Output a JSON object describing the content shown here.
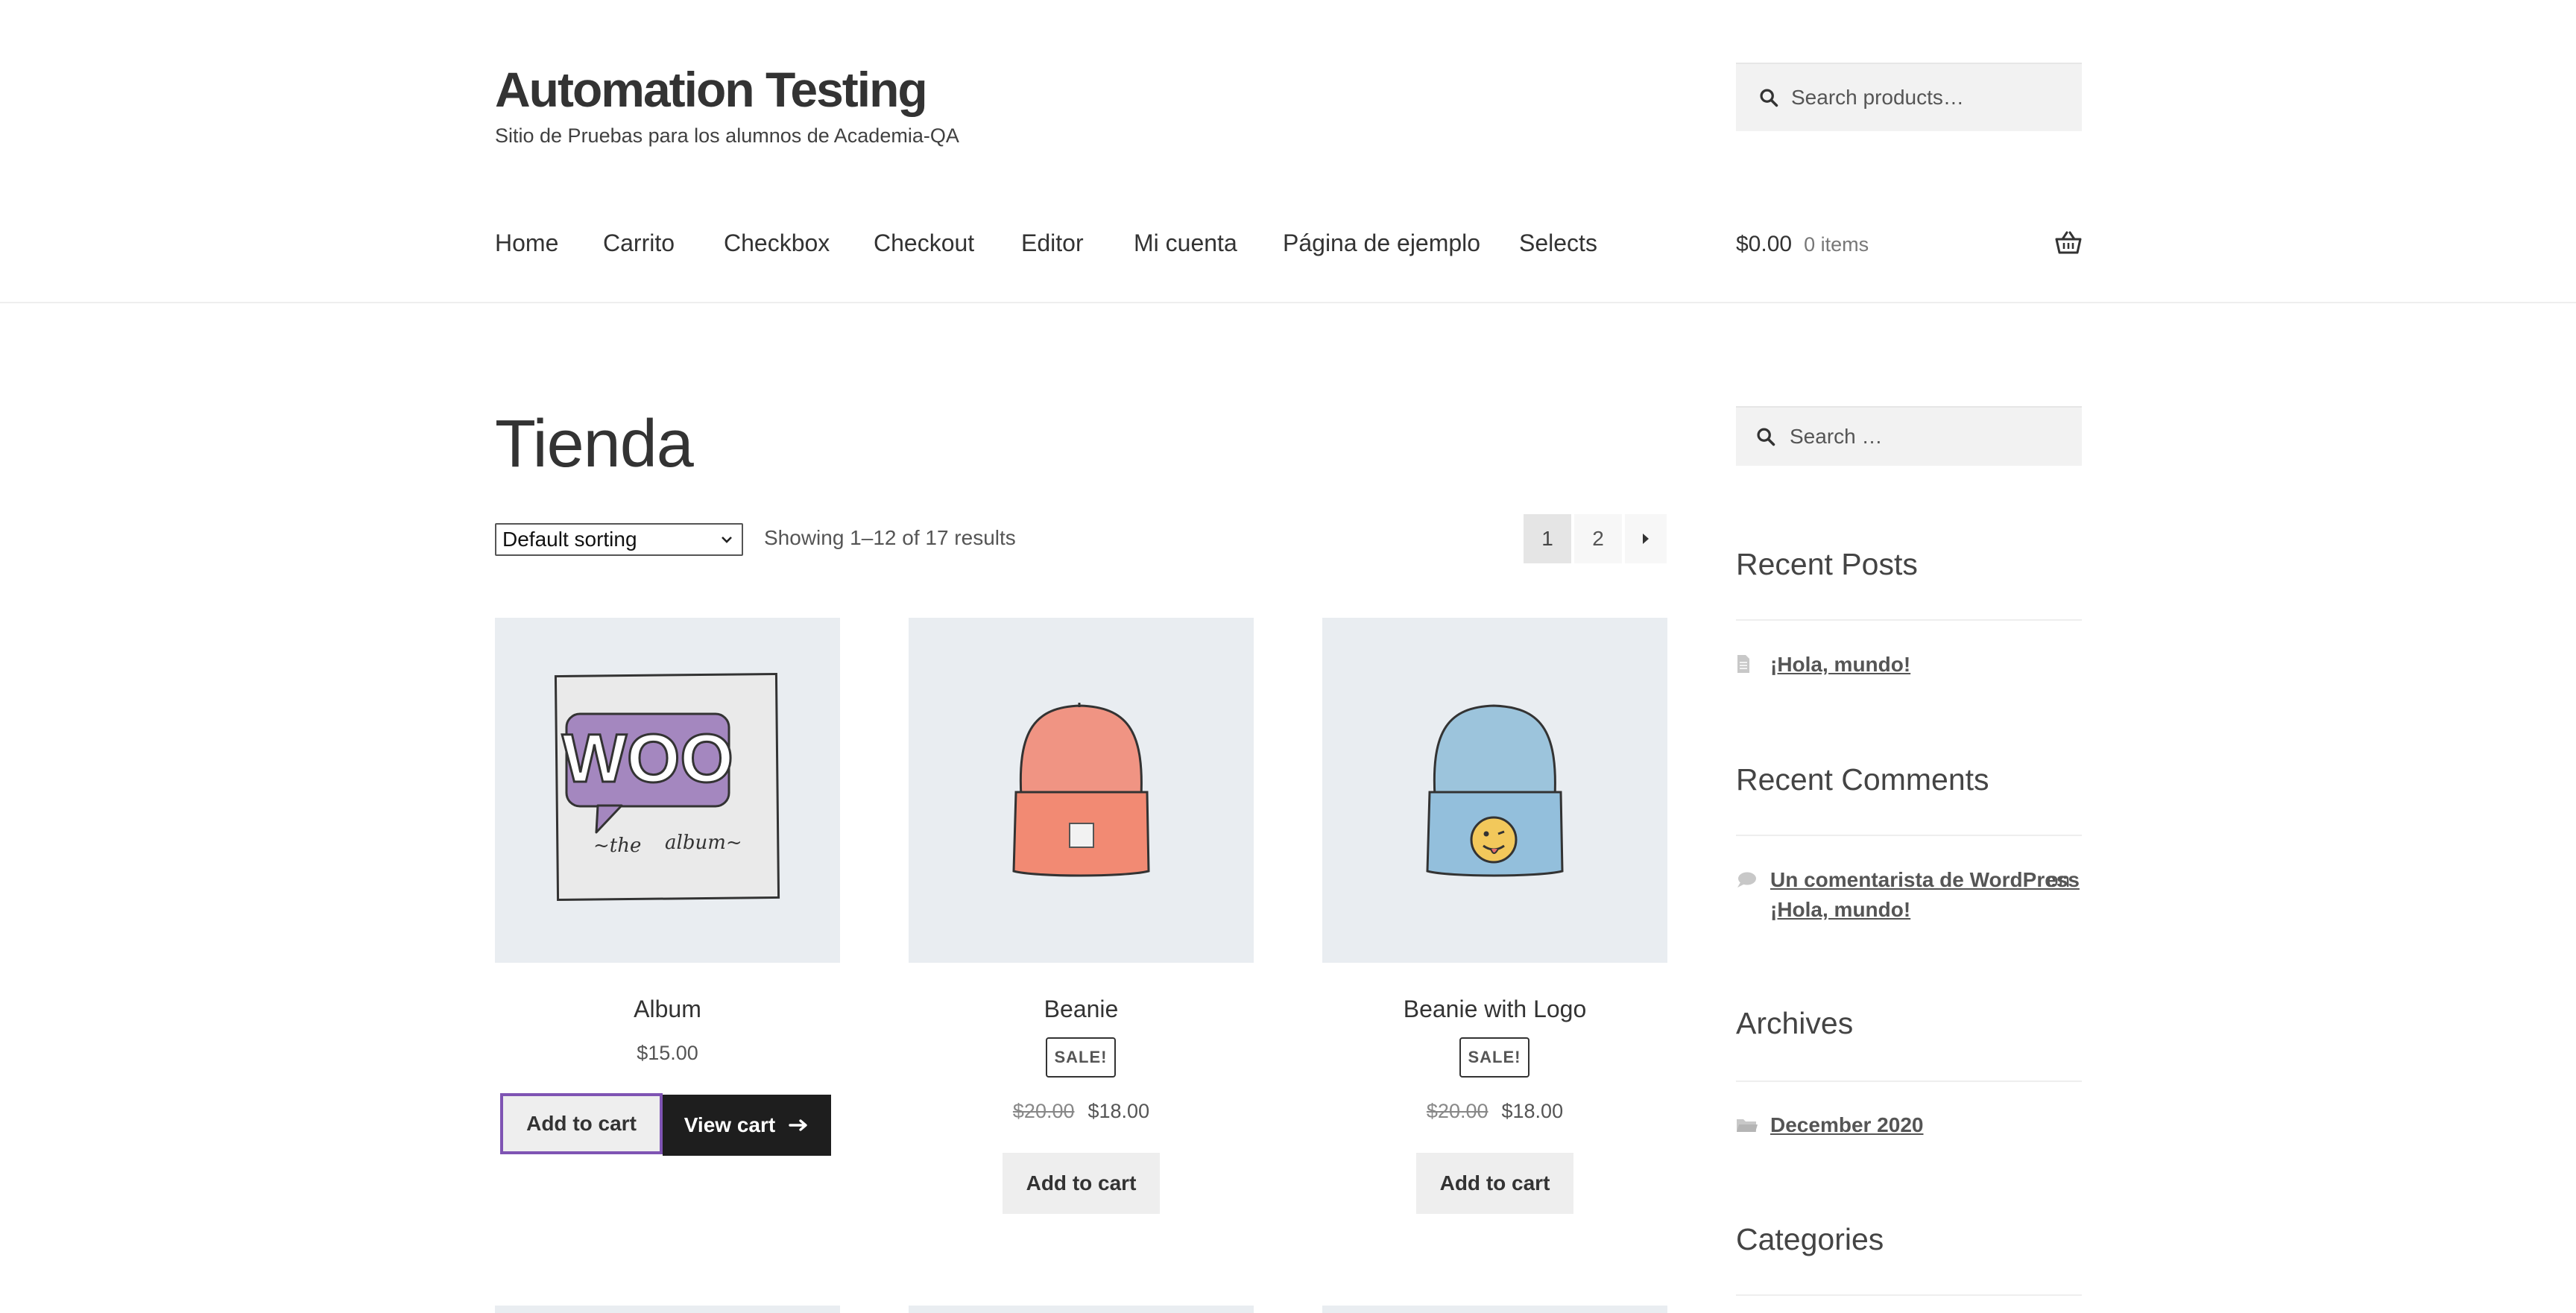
{
  "site": {
    "title": "Automation Testing",
    "description": "Sitio de Pruebas para los alumnos de Academia-QA"
  },
  "header_search": {
    "placeholder": "Search products…",
    "icon": "search-icon"
  },
  "nav": {
    "items": [
      "Home",
      "Carrito",
      "Checkbox",
      "Checkout",
      "Editor",
      "Mi cuenta",
      "Página de ejemplo",
      "Selects"
    ]
  },
  "cart": {
    "amount": "$0.00",
    "count": "0 items",
    "icon": "basket-icon"
  },
  "page": {
    "title": "Tienda"
  },
  "sorting": {
    "selected": "Default sorting"
  },
  "results": {
    "text": "Showing 1–12 of 17 results"
  },
  "pagination": {
    "pages": [
      "1",
      "2"
    ],
    "current": "1",
    "next_icon": "caret-right-icon"
  },
  "products": [
    {
      "name": "Album",
      "price": "$15.00",
      "on_sale": false,
      "button": "Add to cart",
      "view_cart": "View cart"
    },
    {
      "name": "Beanie",
      "badge": "SALE!",
      "old_price": "$20.00",
      "price": "$18.00",
      "on_sale": true,
      "button": "Add to cart"
    },
    {
      "name": "Beanie with Logo",
      "badge": "SALE!",
      "old_price": "$20.00",
      "price": "$18.00",
      "on_sale": true,
      "button": "Add to cart"
    }
  ],
  "sidebar": {
    "search_placeholder": "Search …",
    "recent_posts": {
      "title": "Recent Posts",
      "items": [
        "¡Hola, mundo!"
      ]
    },
    "recent_comments": {
      "title": "Recent Comments",
      "author": "Un comentarista de WordPress",
      "connector": "on",
      "post": "¡Hola, mundo!"
    },
    "archives": {
      "title": "Archives",
      "items": [
        "December 2020"
      ]
    },
    "categories": {
      "title": "Categories"
    }
  },
  "colors": {
    "focus_outline": "#7f54b3",
    "image_bg": "#e9edf1",
    "dark_button": "#1e1e1e"
  }
}
